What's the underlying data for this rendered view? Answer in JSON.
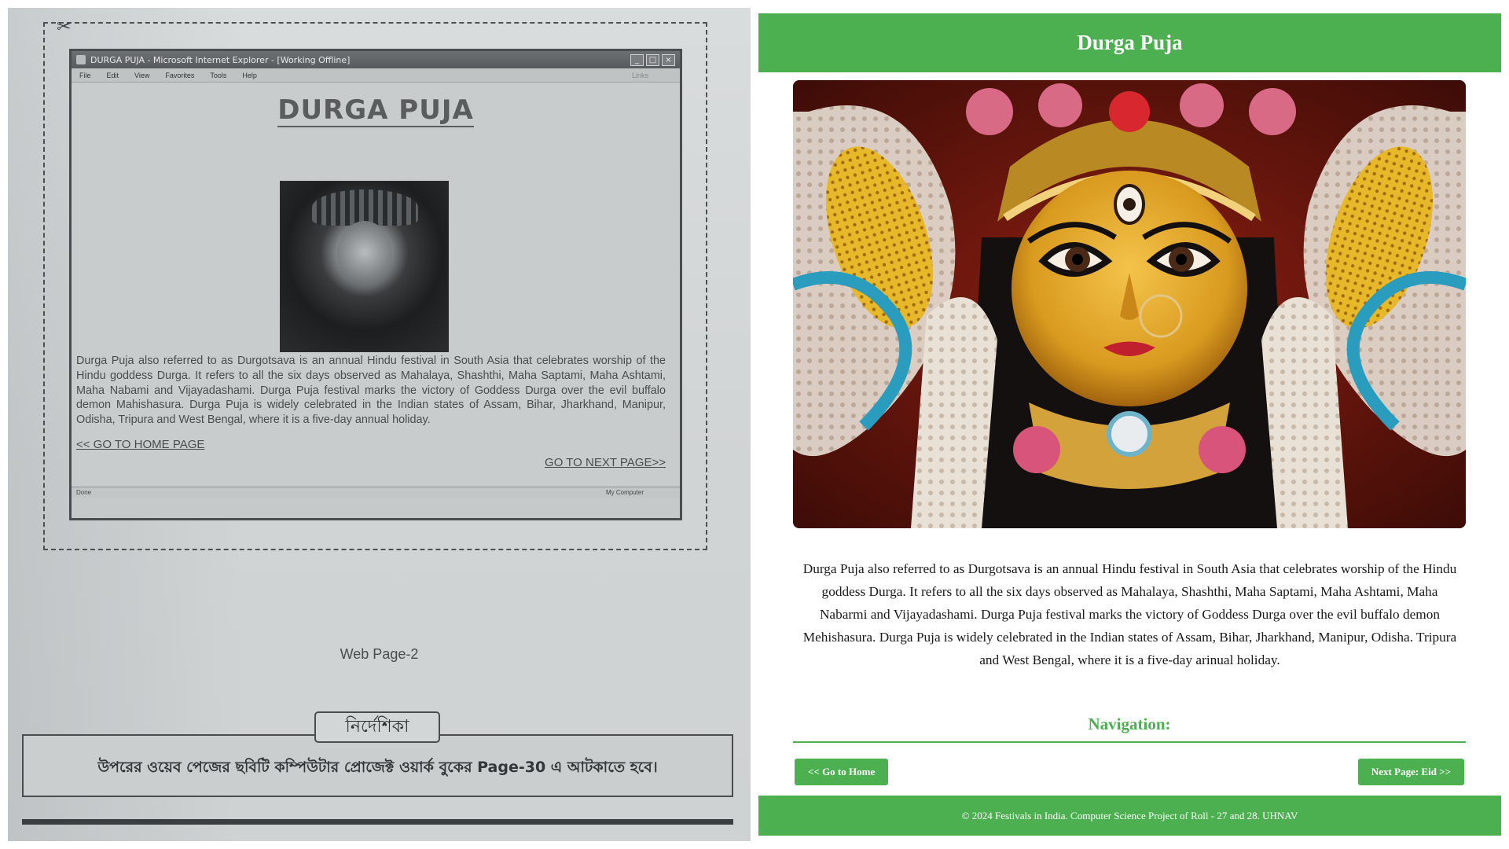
{
  "left_photo": {
    "browser": {
      "title_bar": "DURGA PUJA - Microsoft Internet Explorer - [Working Offline]",
      "menu": [
        "File",
        "Edit",
        "View",
        "Favorites",
        "Tools",
        "Help"
      ],
      "links_label": "Links",
      "status_left": "Done",
      "status_right": "My Computer"
    },
    "page": {
      "heading": "DURGA PUJA",
      "paragraph": "Durga Puja also referred to as Durgotsava is an annual Hindu festival in South Asia that celebrates worship of the Hindu goddess Durga. It refers to all the six days observed as Mahalaya, Shashthi, Maha Saptami, Maha Ashtami, Maha Nabami and Vijayadashami. Durga Puja festival marks the victory of Goddess Durga over the evil buffalo demon Mahishasura. Durga Puja is widely celebrated in the Indian states of Assam, Bihar, Jharkhand, Manipur, Odisha, Tripura and West Bengal, where it is a five-day annual holiday.",
      "home_link": "<< GO TO HOME PAGE",
      "next_link": "GO TO NEXT PAGE>>"
    },
    "caption": "Web Page-2",
    "note_tab": "নির্দেশিকা",
    "note_text": "উপরের ওয়েব পেজের ছবিটি কম্পিউটার প্রোজেক্ট ওয়ার্ক বুকের Page-30 এ আটকাতে হবে।"
  },
  "web_page": {
    "header_title": "Durga Puja",
    "paragraph": "Durga Puja also referred to as Durgotsava is an annual Hindu festival in South Asia that celebrates worship of the Hindu goddess Durga. It refers to all the six days observed as Mahalaya, Shashthi, Maha Saptami, Maha Ashtami, Maha Nabarmi and Vijayadashami. Durga Puja festival marks the victory of Goddess Durga over the evil buffalo demon Mehishasura. Durga Puja is widely celebrated in the Indian states of Assam, Bihar, Jharkhand, Manipur, Odisha. Tripura and West Bengal, where it is a five-day arinual holiday.",
    "nav_heading": "Navigation:",
    "home_button": "<< Go to Home",
    "next_button": "Next Page: Eid >>",
    "footer": "© 2024 Festivals in India. Computer Science Project of Roll - 27 and 28. UHNAV"
  },
  "colors": {
    "accent_green": "#4caf50",
    "paper_grey": "#d5d8d9"
  }
}
